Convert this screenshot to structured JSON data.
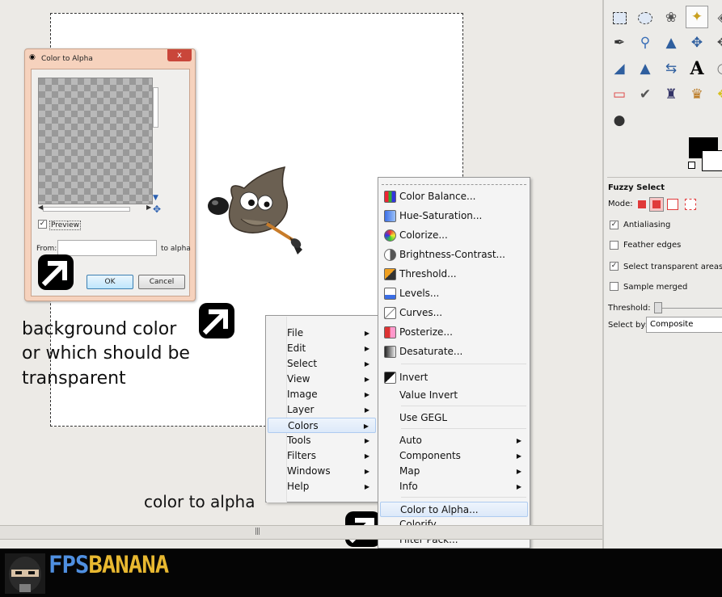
{
  "dialog": {
    "title": "Color to Alpha",
    "close_label": "x",
    "preview_label": "Preview",
    "from_label": "From:",
    "to_alpha_label": "to alpha",
    "ok_label": "OK",
    "cancel_label": "Cancel"
  },
  "annotations": {
    "background_line1": "background color",
    "background_line2": "or which should be",
    "background_line3": "transparent",
    "color_to_alpha": "color to alpha"
  },
  "context_menu": {
    "items": [
      {
        "label": "File"
      },
      {
        "label": "Edit"
      },
      {
        "label": "Select"
      },
      {
        "label": "View"
      },
      {
        "label": "Image"
      },
      {
        "label": "Layer"
      },
      {
        "label": "Colors"
      },
      {
        "label": "Tools"
      },
      {
        "label": "Filters"
      },
      {
        "label": "Windows"
      },
      {
        "label": "Help"
      }
    ]
  },
  "colors_menu": {
    "items": [
      {
        "label": "Color Balance..."
      },
      {
        "label": "Hue-Saturation..."
      },
      {
        "label": "Colorize..."
      },
      {
        "label": "Brightness-Contrast..."
      },
      {
        "label": "Threshold..."
      },
      {
        "label": "Levels..."
      },
      {
        "label": "Curves..."
      },
      {
        "label": "Posterize..."
      },
      {
        "label": "Desaturate..."
      },
      {
        "label": "Invert"
      },
      {
        "label": "Value Invert"
      },
      {
        "label": "Use GEGL"
      },
      {
        "label": "Auto"
      },
      {
        "label": "Components"
      },
      {
        "label": "Map"
      },
      {
        "label": "Info"
      },
      {
        "label": "Color to Alpha..."
      },
      {
        "label": "Colorify..."
      },
      {
        "label": "Filter Pack..."
      }
    ]
  },
  "tool_options": {
    "title": "Fuzzy Select",
    "mode_label": "Mode:",
    "antialiasing": "Antialiasing",
    "feather_edges": "Feather edges",
    "select_transparent": "Select transparent areas",
    "sample_merged": "Sample merged",
    "threshold_label": "Threshold:",
    "select_by_label": "Select by:",
    "select_by_value": "Composite"
  },
  "brand": {
    "part1": "FPS",
    "part2": "BANANA"
  },
  "colors": {
    "menu_highlight": "#dce9f9",
    "brand_blue": "#4f8fe0",
    "brand_yellow": "#e8b830"
  }
}
